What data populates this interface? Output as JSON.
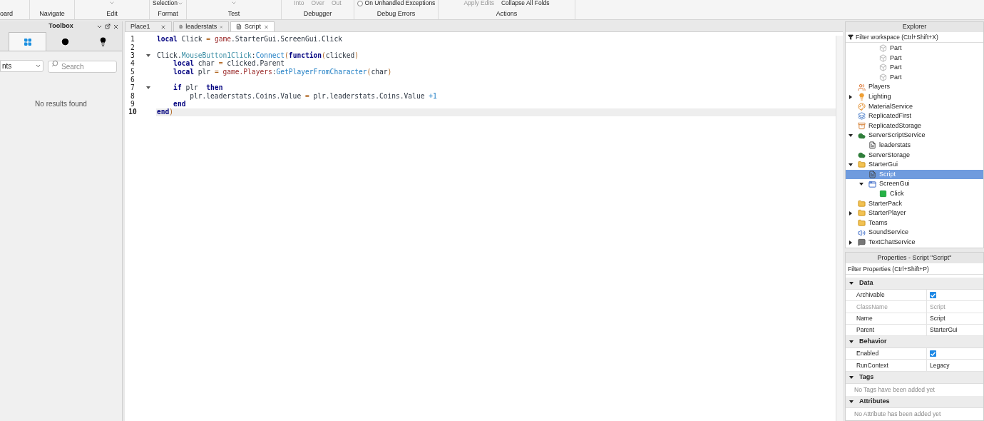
{
  "ribbon": {
    "groups": [
      {
        "label": "oard"
      },
      {
        "label": "Navigate"
      },
      {
        "label": "Edit",
        "top_items": [
          {
            "kind": "caret"
          }
        ]
      },
      {
        "label": "Format",
        "top_items": [
          {
            "kind": "dropdown",
            "text": "Selection"
          }
        ]
      },
      {
        "label": "Test",
        "top_items": [
          {
            "kind": "caret"
          }
        ]
      },
      {
        "label": "Debugger",
        "top_items": [
          {
            "kind": "dim",
            "text": "Into"
          },
          {
            "kind": "dim",
            "text": "Over"
          },
          {
            "kind": "dim",
            "text": "Out"
          }
        ]
      },
      {
        "label": "Debug Errors",
        "top_items": [
          {
            "kind": "radio",
            "text": "On Unhandled Exceptions",
            "selected": false
          }
        ]
      },
      {
        "label": "Actions",
        "top_items": [
          {
            "kind": "dim",
            "text": "Apply Edits"
          },
          {
            "kind": "plain",
            "text": "Collapse All Folds"
          }
        ]
      }
    ]
  },
  "toolbox": {
    "title": "Toolbox",
    "tabs": [
      {
        "kind": "grid",
        "selected": true
      },
      {
        "kind": "clock",
        "selected": false
      },
      {
        "kind": "bulb",
        "selected": false
      }
    ],
    "category": "nts",
    "search": {
      "placeholder": "Search"
    },
    "empty_message": "No results found"
  },
  "editor": {
    "tabs": [
      {
        "label": "Place1",
        "kind": "place",
        "selected": false
      },
      {
        "label": "leaderstats",
        "kind": "script",
        "selected": false
      },
      {
        "label": "Script",
        "kind": "script",
        "selected": true
      }
    ],
    "lines": [
      {
        "number": "1",
        "foldable": false,
        "current": false,
        "tokens": [
          {
            "kind": "kw",
            "text": "local"
          },
          {
            "kind": "p",
            "text": " Click "
          },
          {
            "kind": "op",
            "text": "="
          },
          {
            "kind": "builtin",
            "text": " game"
          },
          {
            "kind": "p",
            "text": ".StarterGui.ScreenGui.Click"
          }
        ]
      },
      {
        "number": "2",
        "foldable": false,
        "current": false
      },
      {
        "number": "3",
        "foldable": true,
        "current": false,
        "tokens": [
          {
            "kind": "p",
            "text": "Click."
          },
          {
            "kind": "prop",
            "text": "MouseButton1Click"
          },
          {
            "kind": "p",
            "text": ":"
          },
          {
            "kind": "method",
            "text": "Connect"
          },
          {
            "kind": "op",
            "text": "("
          },
          {
            "kind": "kw",
            "text": "function"
          },
          {
            "kind": "op",
            "text": "("
          },
          {
            "kind": "p",
            "text": "clicked"
          },
          {
            "kind": "op",
            "text": ")"
          }
        ]
      },
      {
        "number": "4",
        "foldable": false,
        "current": false,
        "tokens": [
          {
            "kind": "kw",
            "text": "    local"
          },
          {
            "kind": "p",
            "text": " char "
          },
          {
            "kind": "op",
            "text": "="
          },
          {
            "kind": "p",
            "text": " clicked.Parent"
          }
        ]
      },
      {
        "number": "5",
        "foldable": false,
        "current": false,
        "tokens": [
          {
            "kind": "kw",
            "text": "    local"
          },
          {
            "kind": "p",
            "text": " plr "
          },
          {
            "kind": "op",
            "text": "="
          },
          {
            "kind": "builtin",
            "text": " game.Players"
          },
          {
            "kind": "p",
            "text": ":"
          },
          {
            "kind": "method",
            "text": "GetPlayerFromCharacter"
          },
          {
            "kind": "op",
            "text": "("
          },
          {
            "kind": "p",
            "text": "char"
          },
          {
            "kind": "op",
            "text": ")"
          }
        ]
      },
      {
        "number": "6",
        "foldable": false,
        "current": false
      },
      {
        "number": "7",
        "foldable": true,
        "current": false,
        "tokens": [
          {
            "kind": "kw",
            "text": "    if"
          },
          {
            "kind": "p",
            "text": " plr  "
          },
          {
            "kind": "kw",
            "text": "then"
          }
        ]
      },
      {
        "number": "8",
        "foldable": false,
        "current": false,
        "tokens": [
          {
            "kind": "p",
            "text": "        plr.leaderstats.Coins.Value "
          },
          {
            "kind": "op",
            "text": "="
          },
          {
            "kind": "p",
            "text": " plr.leaderstats.Coins.Value "
          },
          {
            "kind": "num",
            "text": "+1"
          }
        ]
      },
      {
        "number": "9",
        "foldable": false,
        "current": false,
        "tokens": [
          {
            "kind": "kw",
            "text": "    end"
          }
        ]
      },
      {
        "number": "10",
        "foldable": false,
        "current": true,
        "tokens": [
          {
            "kind": "kw",
            "text": "end"
          },
          {
            "kind": "op",
            "text": ")"
          }
        ]
      }
    ]
  },
  "explorer": {
    "title": "Explorer",
    "filter": {
      "placeholder": "Filter workspace (Ctrl+Shift+X)"
    },
    "tree": [
      {
        "children": [
          {
            "children": [
              {
                "label": "Part",
                "kind": "part",
                "selected": false
              },
              {
                "label": "Part",
                "kind": "part",
                "selected": false
              },
              {
                "label": "Part",
                "kind": "part",
                "selected": false
              },
              {
                "label": "Part",
                "kind": "part",
                "selected": false
              }
            ]
          }
        ]
      },
      {
        "label": "Players",
        "kind": "players",
        "selected": false
      },
      {
        "label": "Lighting",
        "kind": "lighting",
        "selected": false,
        "expanded": false
      },
      {
        "label": "MaterialService",
        "kind": "material",
        "selected": false
      },
      {
        "label": "ReplicatedFirst",
        "kind": "replicated",
        "selected": false
      },
      {
        "label": "ReplicatedStorage",
        "kind": "storage",
        "selected": false
      },
      {
        "label": "ServerScriptService",
        "kind": "cloud",
        "selected": false,
        "expanded": true,
        "children": [
          {
            "label": "leaderstats",
            "kind": "script",
            "selected": false
          }
        ]
      },
      {
        "label": "ServerStorage",
        "kind": "cloud",
        "selected": false
      },
      {
        "label": "StarterGui",
        "kind": "folder",
        "selected": false,
        "expanded": true,
        "children": [
          {
            "label": "Script",
            "kind": "script",
            "selected": true
          },
          {
            "label": "ScreenGui",
            "kind": "screen",
            "selected": false,
            "expanded": true,
            "children": [
              {
                "label": "Click",
                "kind": "textbutton",
                "selected": false
              }
            ]
          }
        ]
      },
      {
        "label": "StarterPack",
        "kind": "folder",
        "selected": false
      },
      {
        "label": "StarterPlayer",
        "kind": "folder",
        "selected": false,
        "expanded": false
      },
      {
        "label": "Teams",
        "kind": "folder",
        "selected": false
      },
      {
        "label": "SoundService",
        "kind": "sound",
        "selected": false
      },
      {
        "label": "TextChatService",
        "kind": "chat",
        "selected": false,
        "expanded": false
      }
    ]
  },
  "properties": {
    "title": "Properties - Script \"Script\"",
    "filter": {
      "placeholder": "Filter Properties (Ctrl+Shift+P)"
    },
    "sections": [
      {
        "title": "Data",
        "expanded": true,
        "rows": [
          {
            "name": "Archivable",
            "kind": "checkbox",
            "checked": true,
            "disabled": false
          },
          {
            "name": "ClassName",
            "kind": "text",
            "value": "Script",
            "disabled": true
          },
          {
            "name": "Name",
            "kind": "text",
            "value": "Script",
            "disabled": false
          },
          {
            "name": "Parent",
            "kind": "text",
            "value": "StarterGui",
            "disabled": false
          }
        ]
      },
      {
        "title": "Behavior",
        "expanded": true,
        "rows": [
          {
            "name": "Enabled",
            "kind": "checkbox",
            "checked": true,
            "disabled": false
          },
          {
            "name": "RunContext",
            "kind": "text",
            "value": "Legacy",
            "disabled": false
          }
        ]
      },
      {
        "title": "Tags",
        "expanded": true,
        "empty": "No Tags have been added yet"
      },
      {
        "title": "Attributes",
        "expanded": true,
        "empty": "No Attribute has been added yet"
      }
    ]
  }
}
